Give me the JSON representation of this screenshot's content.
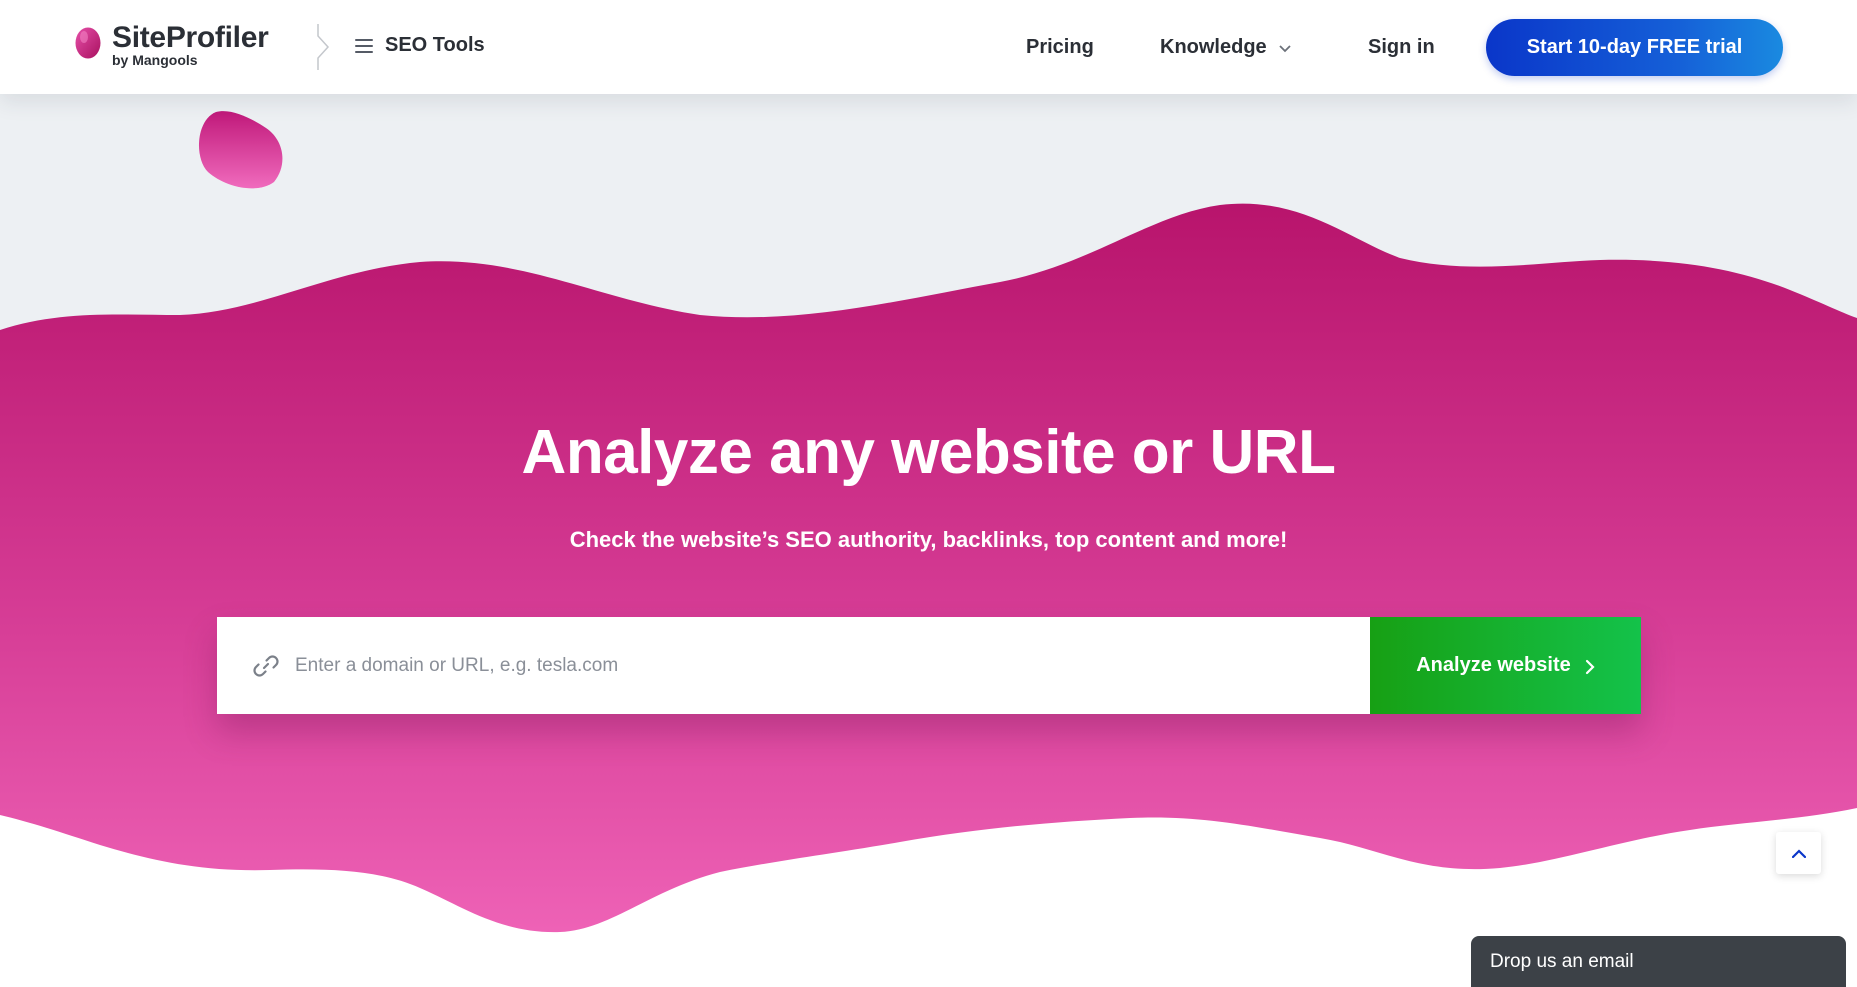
{
  "header": {
    "logo_name": "SiteProfiler",
    "logo_sub": "by Mangools",
    "seo_tools_label": "SEO Tools",
    "nav": {
      "pricing": "Pricing",
      "knowledge": "Knowledge",
      "sign_in": "Sign in"
    },
    "cta_label": "Start 10-day FREE trial"
  },
  "hero": {
    "title": "Analyze any website or URL",
    "subtitle": "Check the website’s SEO authority, backlinks, top content and more!",
    "search": {
      "placeholder": "Enter a domain or URL, e.g. tesla.com",
      "value": "",
      "button_label": "Analyze website"
    }
  },
  "chat_widget": {
    "label": "Drop us an email"
  },
  "colors": {
    "brand_magenta": "#b8146c",
    "brand_pink": "#ea5bb0",
    "cta_blue": "#0a36c9",
    "analyze_green": "#14c24a"
  },
  "icons": [
    "menu-icon",
    "chevron-down-icon",
    "link-icon",
    "chevron-right-icon",
    "chevron-up-icon"
  ]
}
